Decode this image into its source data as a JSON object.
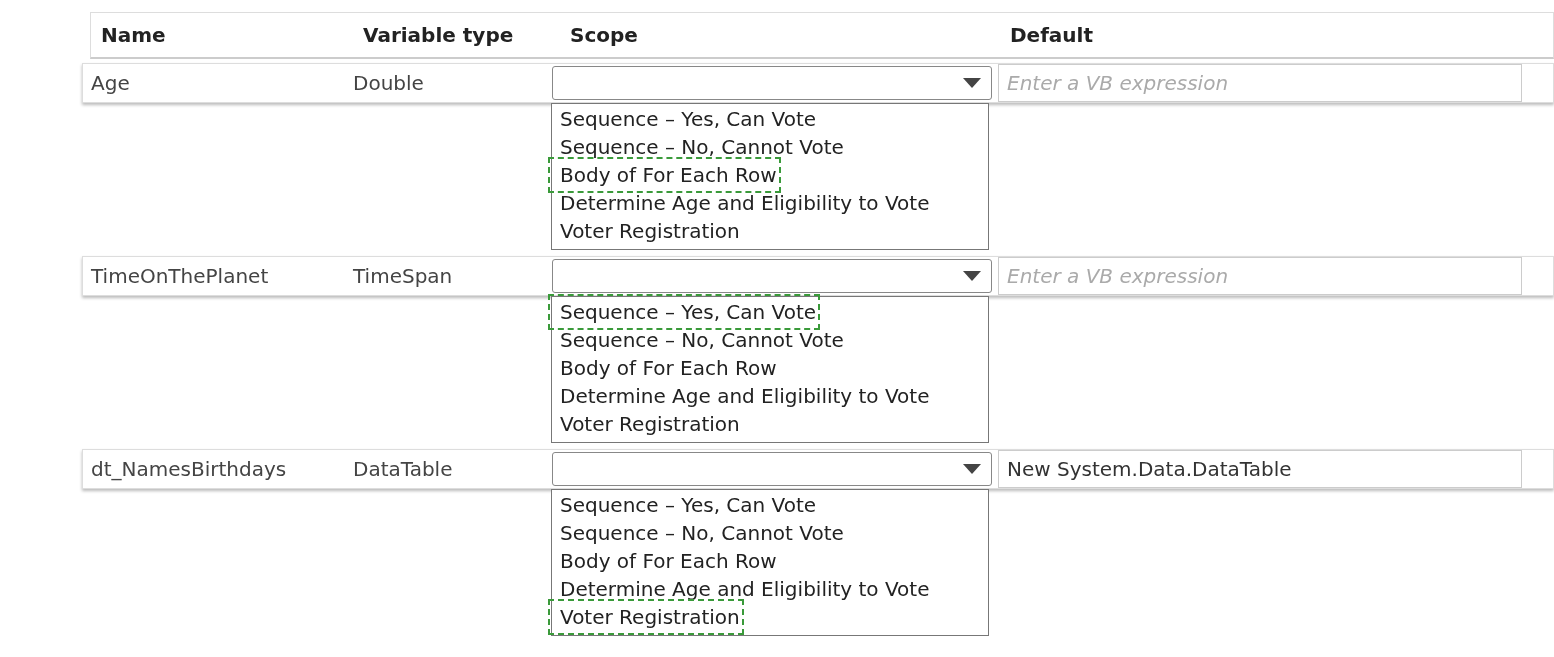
{
  "columns": [
    "Name",
    "Variable type",
    "Scope",
    "Default"
  ],
  "variables": [
    {
      "name": "Age",
      "type": "Double",
      "scope_options": [
        {
          "label": "Sequence – Yes, Can Vote",
          "highlighted": false
        },
        {
          "label": "Sequence – No, Cannot Vote",
          "highlighted": false
        },
        {
          "label": "Body of For Each Row",
          "highlighted": true
        },
        {
          "label": "Determine Age and Eligibility to Vote",
          "highlighted": false
        },
        {
          "label": "Voter Registration",
          "highlighted": false
        }
      ],
      "default": {
        "placeholder": "Enter a VB expression"
      }
    },
    {
      "name": "TimeOnThePlanet",
      "type": "TimeSpan",
      "scope_options": [
        {
          "label": "Sequence – Yes, Can Vote",
          "highlighted": true
        },
        {
          "label": "Sequence – No, Cannot Vote",
          "highlighted": false
        },
        {
          "label": "Body of For Each Row",
          "highlighted": false
        },
        {
          "label": "Determine Age and Eligibility to Vote",
          "highlighted": false
        },
        {
          "label": "Voter Registration",
          "highlighted": false
        }
      ],
      "default": {
        "placeholder": "Enter a VB expression"
      }
    },
    {
      "name": "dt_NamesBirthdays",
      "type": "DataTable",
      "scope_options": [
        {
          "label": "Sequence – Yes, Can Vote",
          "highlighted": false
        },
        {
          "label": "Sequence – No, Cannot Vote",
          "highlighted": false
        },
        {
          "label": "Body of For Each Row",
          "highlighted": false
        },
        {
          "label": "Determine Age and Eligibility to Vote",
          "highlighted": false
        },
        {
          "label": "Voter Registration",
          "highlighted": true
        }
      ],
      "default": {
        "value": "New System.Data.DataTable"
      }
    }
  ]
}
